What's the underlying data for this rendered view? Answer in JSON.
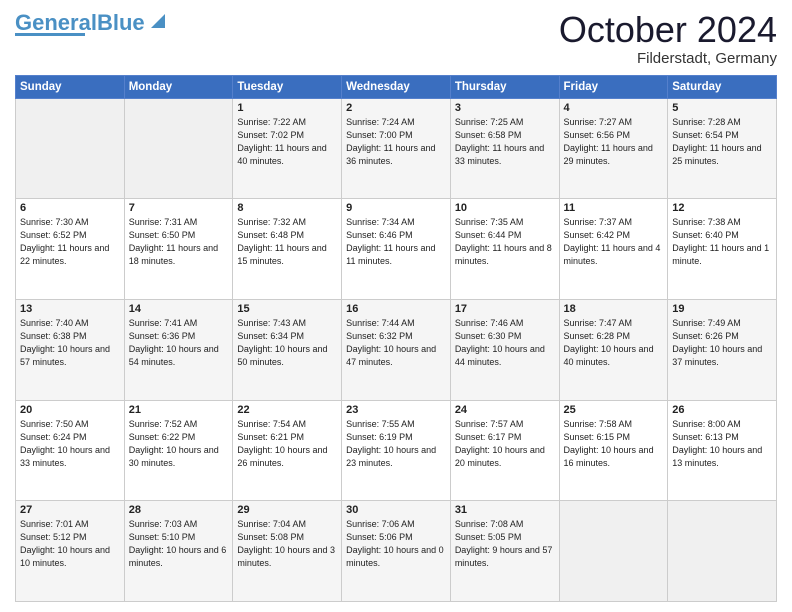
{
  "header": {
    "logo": {
      "part1": "General",
      "part2": "Blue"
    },
    "title": "October 2024",
    "location": "Filderstadt, Germany"
  },
  "weekdays": [
    "Sunday",
    "Monday",
    "Tuesday",
    "Wednesday",
    "Thursday",
    "Friday",
    "Saturday"
  ],
  "weeks": [
    [
      {
        "day": "",
        "info": ""
      },
      {
        "day": "",
        "info": ""
      },
      {
        "day": "1",
        "info": "Sunrise: 7:22 AM\nSunset: 7:02 PM\nDaylight: 11 hours and 40 minutes."
      },
      {
        "day": "2",
        "info": "Sunrise: 7:24 AM\nSunset: 7:00 PM\nDaylight: 11 hours and 36 minutes."
      },
      {
        "day": "3",
        "info": "Sunrise: 7:25 AM\nSunset: 6:58 PM\nDaylight: 11 hours and 33 minutes."
      },
      {
        "day": "4",
        "info": "Sunrise: 7:27 AM\nSunset: 6:56 PM\nDaylight: 11 hours and 29 minutes."
      },
      {
        "day": "5",
        "info": "Sunrise: 7:28 AM\nSunset: 6:54 PM\nDaylight: 11 hours and 25 minutes."
      }
    ],
    [
      {
        "day": "6",
        "info": "Sunrise: 7:30 AM\nSunset: 6:52 PM\nDaylight: 11 hours and 22 minutes."
      },
      {
        "day": "7",
        "info": "Sunrise: 7:31 AM\nSunset: 6:50 PM\nDaylight: 11 hours and 18 minutes."
      },
      {
        "day": "8",
        "info": "Sunrise: 7:32 AM\nSunset: 6:48 PM\nDaylight: 11 hours and 15 minutes."
      },
      {
        "day": "9",
        "info": "Sunrise: 7:34 AM\nSunset: 6:46 PM\nDaylight: 11 hours and 11 minutes."
      },
      {
        "day": "10",
        "info": "Sunrise: 7:35 AM\nSunset: 6:44 PM\nDaylight: 11 hours and 8 minutes."
      },
      {
        "day": "11",
        "info": "Sunrise: 7:37 AM\nSunset: 6:42 PM\nDaylight: 11 hours and 4 minutes."
      },
      {
        "day": "12",
        "info": "Sunrise: 7:38 AM\nSunset: 6:40 PM\nDaylight: 11 hours and 1 minute."
      }
    ],
    [
      {
        "day": "13",
        "info": "Sunrise: 7:40 AM\nSunset: 6:38 PM\nDaylight: 10 hours and 57 minutes."
      },
      {
        "day": "14",
        "info": "Sunrise: 7:41 AM\nSunset: 6:36 PM\nDaylight: 10 hours and 54 minutes."
      },
      {
        "day": "15",
        "info": "Sunrise: 7:43 AM\nSunset: 6:34 PM\nDaylight: 10 hours and 50 minutes."
      },
      {
        "day": "16",
        "info": "Sunrise: 7:44 AM\nSunset: 6:32 PM\nDaylight: 10 hours and 47 minutes."
      },
      {
        "day": "17",
        "info": "Sunrise: 7:46 AM\nSunset: 6:30 PM\nDaylight: 10 hours and 44 minutes."
      },
      {
        "day": "18",
        "info": "Sunrise: 7:47 AM\nSunset: 6:28 PM\nDaylight: 10 hours and 40 minutes."
      },
      {
        "day": "19",
        "info": "Sunrise: 7:49 AM\nSunset: 6:26 PM\nDaylight: 10 hours and 37 minutes."
      }
    ],
    [
      {
        "day": "20",
        "info": "Sunrise: 7:50 AM\nSunset: 6:24 PM\nDaylight: 10 hours and 33 minutes."
      },
      {
        "day": "21",
        "info": "Sunrise: 7:52 AM\nSunset: 6:22 PM\nDaylight: 10 hours and 30 minutes."
      },
      {
        "day": "22",
        "info": "Sunrise: 7:54 AM\nSunset: 6:21 PM\nDaylight: 10 hours and 26 minutes."
      },
      {
        "day": "23",
        "info": "Sunrise: 7:55 AM\nSunset: 6:19 PM\nDaylight: 10 hours and 23 minutes."
      },
      {
        "day": "24",
        "info": "Sunrise: 7:57 AM\nSunset: 6:17 PM\nDaylight: 10 hours and 20 minutes."
      },
      {
        "day": "25",
        "info": "Sunrise: 7:58 AM\nSunset: 6:15 PM\nDaylight: 10 hours and 16 minutes."
      },
      {
        "day": "26",
        "info": "Sunrise: 8:00 AM\nSunset: 6:13 PM\nDaylight: 10 hours and 13 minutes."
      }
    ],
    [
      {
        "day": "27",
        "info": "Sunrise: 7:01 AM\nSunset: 5:12 PM\nDaylight: 10 hours and 10 minutes."
      },
      {
        "day": "28",
        "info": "Sunrise: 7:03 AM\nSunset: 5:10 PM\nDaylight: 10 hours and 6 minutes."
      },
      {
        "day": "29",
        "info": "Sunrise: 7:04 AM\nSunset: 5:08 PM\nDaylight: 10 hours and 3 minutes."
      },
      {
        "day": "30",
        "info": "Sunrise: 7:06 AM\nSunset: 5:06 PM\nDaylight: 10 hours and 0 minutes."
      },
      {
        "day": "31",
        "info": "Sunrise: 7:08 AM\nSunset: 5:05 PM\nDaylight: 9 hours and 57 minutes."
      },
      {
        "day": "",
        "info": ""
      },
      {
        "day": "",
        "info": ""
      }
    ]
  ]
}
